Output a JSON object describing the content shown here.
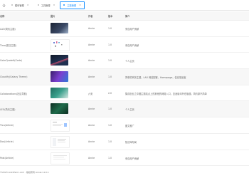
{
  "tabs": [
    {
      "label": "模块管理",
      "active": false
    },
    {
      "label": "工具管理",
      "active": false
    },
    {
      "label": "主题管理",
      "active": true
    }
  ],
  "table": {
    "headers": [
      "名称",
      "图片",
      "作者",
      "版本",
      "简介"
    ],
    "rows": [
      {
        "name": "LAO(简约主题)",
        "author": "Annie",
        "version": "1.0",
        "desc": "来自用户贡献"
      },
      {
        "name": "Timo(夏日主题)",
        "author": "Annie",
        "version": "1.0",
        "desc": "来自用户贡献"
      },
      {
        "name": "ColorQuoteIt(Code)",
        "author": "Annie",
        "version": "1.0",
        "desc": "个人主页"
      },
      {
        "name": "Cloudify(Galaxy Theme)",
        "author": "Annie",
        "version": "1.0",
        "desc": "简单的商务主题，LAO 网站配置，Homepage，信息量适宜"
      },
      {
        "name": "Collaborations(社区导航)",
        "author": "六安",
        "version": "2.0",
        "desc": "集成创业之中圈主题站点上的其他的网络入口，至适版本外在版题，简约原不简单"
      },
      {
        "name": "LEO(简约主题)",
        "author": "Annie",
        "version": "1.0",
        "desc": "个人主页"
      },
      {
        "name": "Ticu(Article)",
        "author": "Annie",
        "version": "1.0",
        "desc": "图文推广"
      },
      {
        "name": "Doc(Article)",
        "author": "Annie",
        "version": "1.0",
        "desc": "知识库布局"
      },
      {
        "name": "Post(Article)",
        "author": "Annie",
        "version": "1.0",
        "desc": "来自用户贡献"
      }
    ]
  },
  "footer": {
    "text": "©2023 LinkShinic.com · 版权所有 Annie v1.0.1"
  },
  "colors": {
    "accent": "#1890ff",
    "header_bg": "#f7f7f7"
  }
}
